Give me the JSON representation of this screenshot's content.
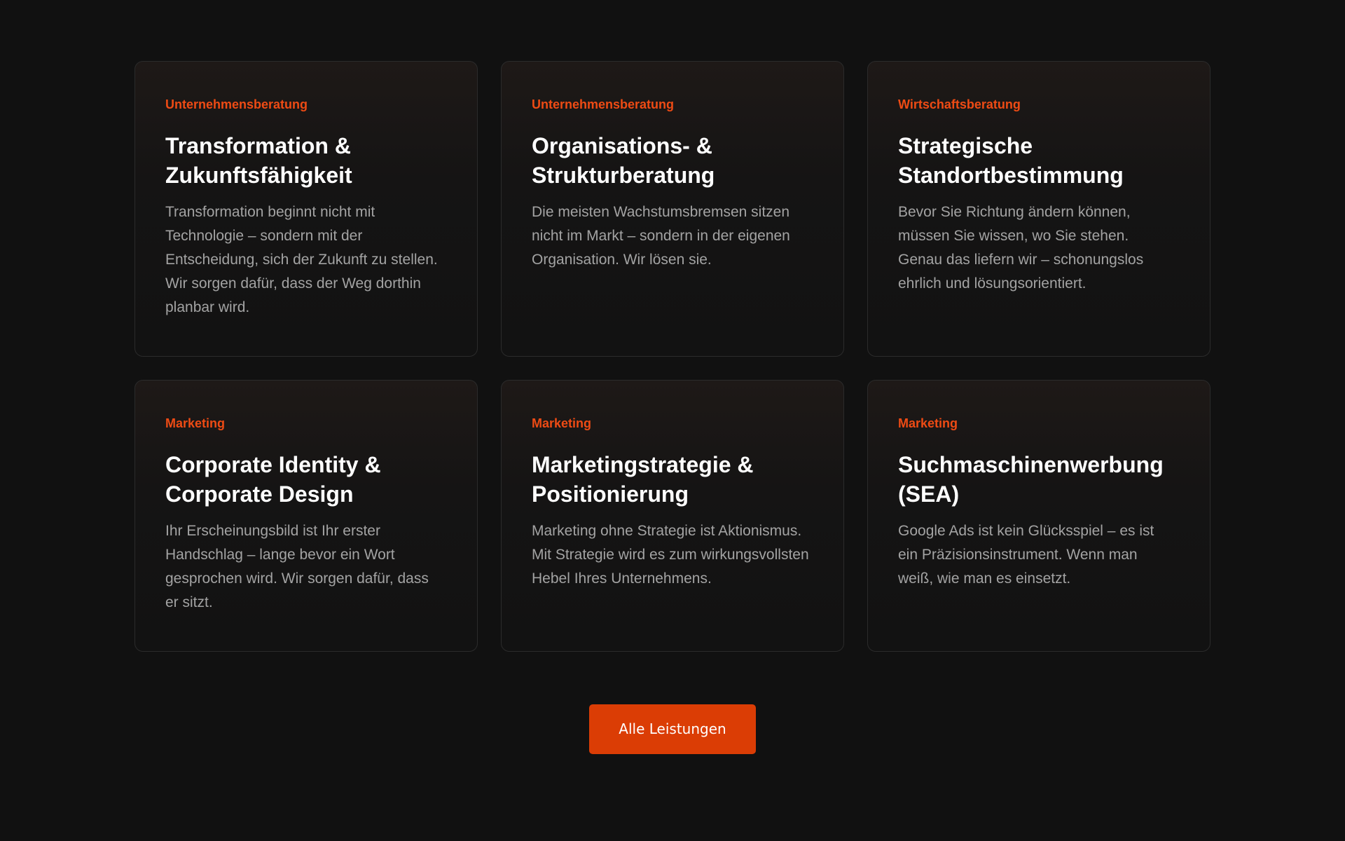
{
  "cards": [
    {
      "category": "Unternehmensberatung",
      "title_lines": [
        "Transformation &",
        "Zukunftsfähigkeit"
      ],
      "description_lines": [
        "Transformation beginnt nicht mit",
        "Technologie – sondern mit der",
        "Entscheidung, sich der Zukunft zu stellen.",
        "Wir sorgen dafür, dass der Weg dorthin",
        "planbar wird."
      ]
    },
    {
      "category": "Unternehmensberatung",
      "title_lines": [
        "Organisations- &",
        "Strukturberatung"
      ],
      "description_lines": [
        "Die meisten Wachstumsbremsen sitzen",
        "nicht im Markt – sondern in der eigenen",
        "Organisation. Wir lösen sie."
      ]
    },
    {
      "category": "Wirtschaftsberatung",
      "title_lines": [
        "Strategische",
        "Standortbestimmung"
      ],
      "description_lines": [
        "Bevor Sie Richtung ändern können,",
        "müssen Sie wissen, wo Sie stehen.",
        "Genau das liefern wir – schonungslos",
        "ehrlich und lösungsorientiert."
      ]
    },
    {
      "category": "Marketing",
      "title_lines": [
        "Corporate Identity &",
        "Corporate Design"
      ],
      "description_lines": [
        "Ihr Erscheinungsbild ist Ihr erster",
        "Handschlag – lange bevor ein Wort",
        "gesprochen wird. Wir sorgen dafür, dass",
        "er sitzt."
      ]
    },
    {
      "category": "Marketing",
      "title_lines": [
        "Marketingstrategie &",
        "Positionierung"
      ],
      "description_lines": [
        "Marketing ohne Strategie ist Aktionismus.",
        "Mit Strategie wird es zum wirkungsvollsten",
        "Hebel Ihres Unternehmens."
      ]
    },
    {
      "category": "Marketing",
      "title_lines": [
        "Suchmaschinenwerbung",
        "(SEA)"
      ],
      "description_lines": [
        "Google Ads ist kein Glücksspiel – es ist",
        "ein Präzisionsinstrument. Wenn man",
        "weiß, wie man es einsetzt."
      ]
    }
  ],
  "cta": {
    "label": "Alle Leistungen"
  },
  "colors": {
    "background": "#111111",
    "accent": "#db3d05",
    "category_text": "#ee4b14",
    "title_text": "#ffffff",
    "body_text": "#a3a3a3",
    "card_border": "#2b2b2b"
  }
}
